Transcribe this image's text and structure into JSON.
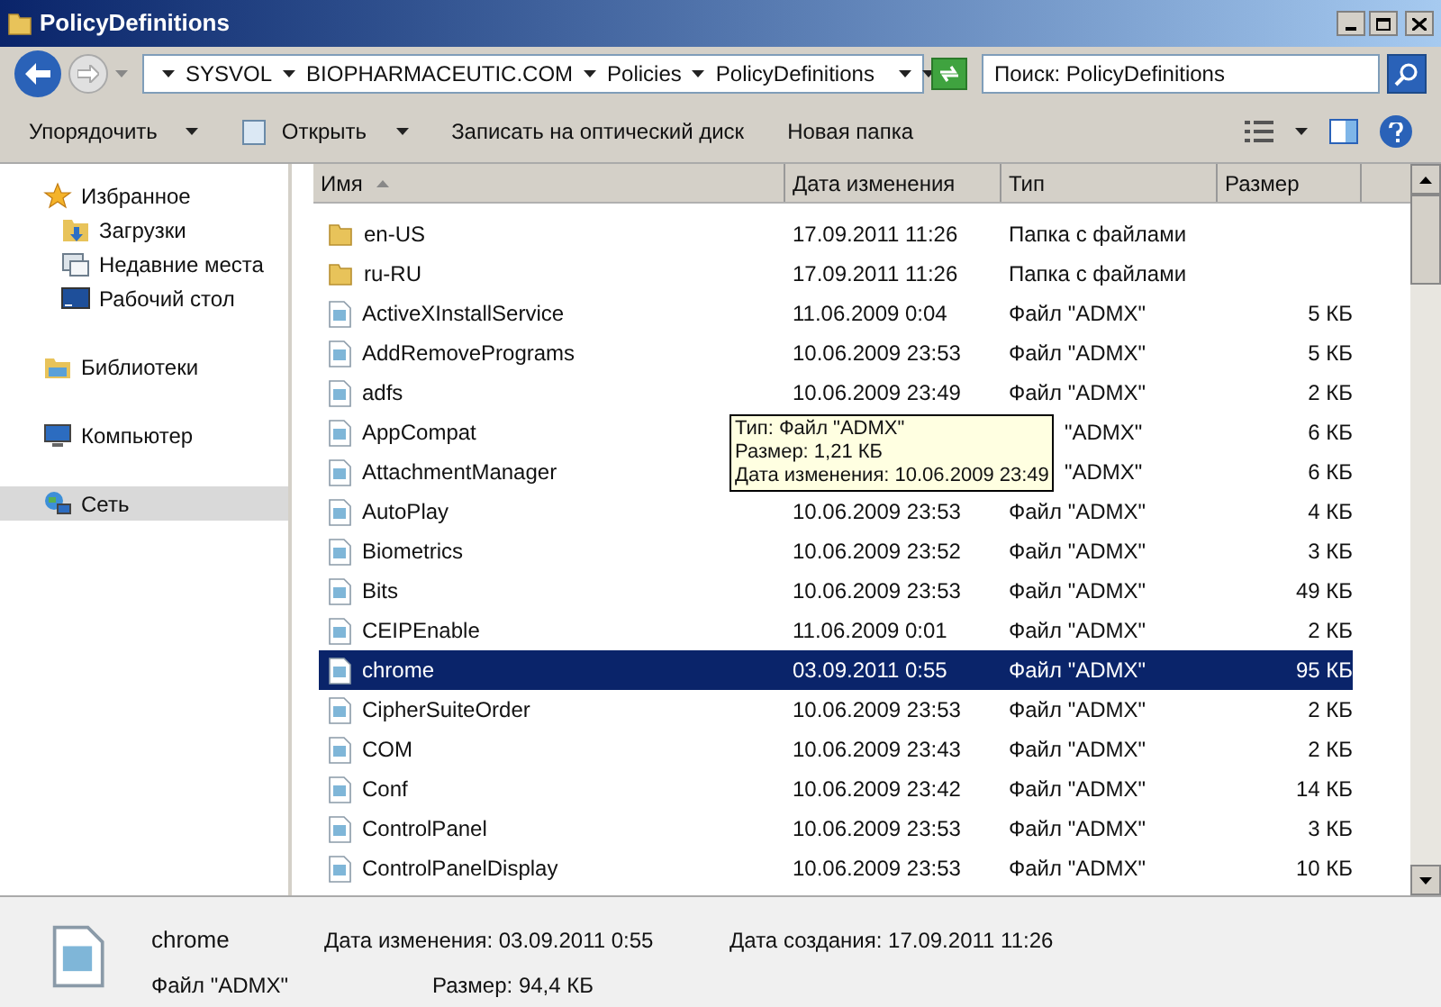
{
  "window": {
    "title": "PolicyDefinitions"
  },
  "address": {
    "crumbs": [
      "SYSVOL",
      "BIOPHARMACEUTIC.COM",
      "Policies",
      "PolicyDefinitions"
    ]
  },
  "search": {
    "placeholder": "Поиск: PolicyDefinitions"
  },
  "toolbar": [
    {
      "label": "Упорядочить",
      "kind": "menu"
    },
    {
      "label": "Открыть",
      "kind": "open"
    },
    {
      "label": "Записать на оптический диск",
      "kind": "plain"
    },
    {
      "label": "Новая папка",
      "kind": "plain"
    }
  ],
  "sidebar": {
    "items": [
      {
        "label": "Избранное",
        "kind": "star",
        "group": true,
        "selected": false
      },
      {
        "label": "Загрузки",
        "kind": "downloads",
        "group": false,
        "selected": false
      },
      {
        "label": "Недавние места",
        "kind": "recent",
        "group": false,
        "selected": false
      },
      {
        "label": "Рабочий стол",
        "kind": "desktop",
        "group": false,
        "selected": false
      },
      {
        "label": "Библиотеки",
        "kind": "library",
        "group": true,
        "selected": false
      },
      {
        "label": "Компьютер",
        "kind": "computer",
        "group": true,
        "selected": false
      },
      {
        "label": "Сеть",
        "kind": "network",
        "group": true,
        "selected": true
      }
    ]
  },
  "table": {
    "columns": [
      "Имя",
      "Дата изменения",
      "Тип",
      "Размер"
    ],
    "rows": [
      {
        "name": "en-US",
        "kind": "folder",
        "date": "17.09.2011 11:26",
        "type": "Папка с файлами",
        "selected": false
      },
      {
        "name": "ru-RU",
        "kind": "folder",
        "date": "17.09.2011 11:26",
        "type": "Папка с файлами",
        "selected": false
      },
      {
        "name": "ActiveXInstallService",
        "kind": "file",
        "date": "11.06.2009 0:04",
        "type": "Файл \"ADMX\"",
        "size": "5 КБ",
        "selected": false
      },
      {
        "name": "AddRemovePrograms",
        "kind": "file",
        "date": "10.06.2009 23:53",
        "type": "Файл \"ADMX\"",
        "size": "5 КБ",
        "selected": false
      },
      {
        "name": "adfs",
        "kind": "file",
        "date": "10.06.2009 23:49",
        "type": "Файл \"ADMX\"",
        "size": "2 КБ",
        "selected": false
      },
      {
        "name": "AppCompat",
        "kind": "file",
        "type": "\"ADMX\"",
        "size": "6 КБ",
        "selected": false
      },
      {
        "name": "AttachmentManager",
        "kind": "file",
        "type": "\"ADMX\"",
        "size": "6 КБ",
        "selected": false
      },
      {
        "name": "AutoPlay",
        "kind": "file",
        "date": "10.06.2009 23:53",
        "type": "Файл \"ADMX\"",
        "size": "4 КБ",
        "selected": false
      },
      {
        "name": "Biometrics",
        "kind": "file",
        "date": "10.06.2009 23:52",
        "type": "Файл \"ADMX\"",
        "size": "3 КБ",
        "selected": false
      },
      {
        "name": "Bits",
        "kind": "file",
        "date": "10.06.2009 23:53",
        "type": "Файл \"ADMX\"",
        "size": "49 КБ",
        "selected": false
      },
      {
        "name": "CEIPEnable",
        "kind": "file",
        "date": "11.06.2009 0:01",
        "type": "Файл \"ADMX\"",
        "size": "2 КБ",
        "selected": false
      },
      {
        "name": "chrome",
        "kind": "file",
        "date": "03.09.2011 0:55",
        "type": "Файл \"ADMX\"",
        "size": "95 КБ",
        "selected": true
      },
      {
        "name": "CipherSuiteOrder",
        "kind": "file",
        "date": "10.06.2009 23:53",
        "type": "Файл \"ADMX\"",
        "size": "2 КБ",
        "selected": false
      },
      {
        "name": "COM",
        "kind": "file",
        "date": "10.06.2009 23:43",
        "type": "Файл \"ADMX\"",
        "size": "2 КБ",
        "selected": false
      },
      {
        "name": "Conf",
        "kind": "file",
        "date": "10.06.2009 23:42",
        "type": "Файл \"ADMX\"",
        "size": "14 КБ",
        "selected": false
      },
      {
        "name": "ControlPanel",
        "kind": "file",
        "date": "10.06.2009 23:53",
        "type": "Файл \"ADMX\"",
        "size": "3 КБ",
        "selected": false
      },
      {
        "name": "ControlPanelDisplay",
        "kind": "file",
        "date": "10.06.2009 23:53",
        "type": "Файл \"ADMX\"",
        "size": "10 КБ",
        "selected": false
      }
    ]
  },
  "tooltip": {
    "lines": [
      "Тип: Файл \"ADMX\"",
      "Размер: 1,21 КБ",
      "Дата изменения: 10.06.2009 23:49"
    ]
  },
  "details": {
    "name": "chrome",
    "type": "Файл \"ADMX\"",
    "modified_label": "Дата изменения:",
    "modified": "03.09.2011 0:55",
    "created_label": "Дата создания:",
    "created": "17.09.2011 11:26",
    "size_label": "Размер:",
    "size": "94,4 КБ"
  }
}
